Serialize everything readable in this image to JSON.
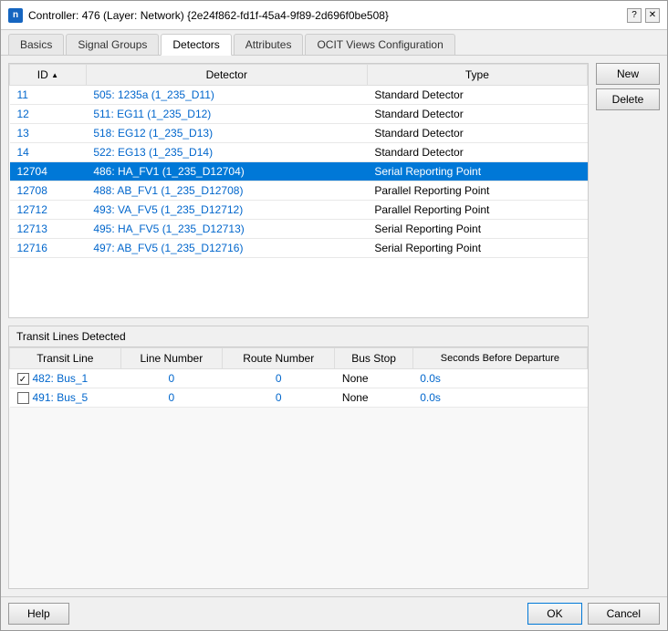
{
  "window": {
    "title": "Controller: 476 (Layer: Network) {2e24f862-fd1f-45a4-9f89-2d696f0be508}",
    "icon_label": "n",
    "help_button": "?",
    "close_button": "✕"
  },
  "tabs": [
    {
      "label": "Basics",
      "active": false
    },
    {
      "label": "Signal Groups",
      "active": false
    },
    {
      "label": "Detectors",
      "active": true
    },
    {
      "label": "Attributes",
      "active": false
    },
    {
      "label": "OCIT Views Configuration",
      "active": false
    }
  ],
  "table": {
    "columns": [
      "ID",
      "Detector",
      "Type"
    ],
    "rows": [
      {
        "id": "11",
        "detector": "505: 1235a (1_235_D11)",
        "type": "Standard Detector",
        "selected": false
      },
      {
        "id": "12",
        "detector": "511: EG11 (1_235_D12)",
        "type": "Standard Detector",
        "selected": false
      },
      {
        "id": "13",
        "detector": "518: EG12 (1_235_D13)",
        "type": "Standard Detector",
        "selected": false
      },
      {
        "id": "14",
        "detector": "522: EG13 (1_235_D14)",
        "type": "Standard Detector",
        "selected": false
      },
      {
        "id": "12704",
        "detector": "486: HA_FV1 (1_235_D12704)",
        "type": "Serial Reporting Point",
        "selected": true
      },
      {
        "id": "12708",
        "detector": "488: AB_FV1 (1_235_D12708)",
        "type": "Parallel Reporting Point",
        "selected": false
      },
      {
        "id": "12712",
        "detector": "493: VA_FV5 (1_235_D12712)",
        "type": "Parallel Reporting Point",
        "selected": false
      },
      {
        "id": "12713",
        "detector": "495: HA_FV5 (1_235_D12713)",
        "type": "Serial Reporting Point",
        "selected": false
      },
      {
        "id": "12716",
        "detector": "497: AB_FV5 (1_235_D12716)",
        "type": "Serial Reporting Point",
        "selected": false
      }
    ]
  },
  "buttons": {
    "new_label": "New",
    "delete_label": "Delete"
  },
  "transit": {
    "section_title": "Transit Lines Detected",
    "columns": [
      "Transit Line",
      "Line Number",
      "Route Number",
      "Bus Stop",
      "Seconds Before Departure"
    ],
    "rows": [
      {
        "checked": true,
        "line": "482: Bus_1",
        "line_number": "0",
        "route_number": "0",
        "bus_stop": "None",
        "seconds": "0.0s"
      },
      {
        "checked": false,
        "line": "491: Bus_5",
        "line_number": "0",
        "route_number": "0",
        "bus_stop": "None",
        "seconds": "0.0s"
      }
    ]
  },
  "footer": {
    "help_label": "Help",
    "ok_label": "OK",
    "cancel_label": "Cancel"
  }
}
